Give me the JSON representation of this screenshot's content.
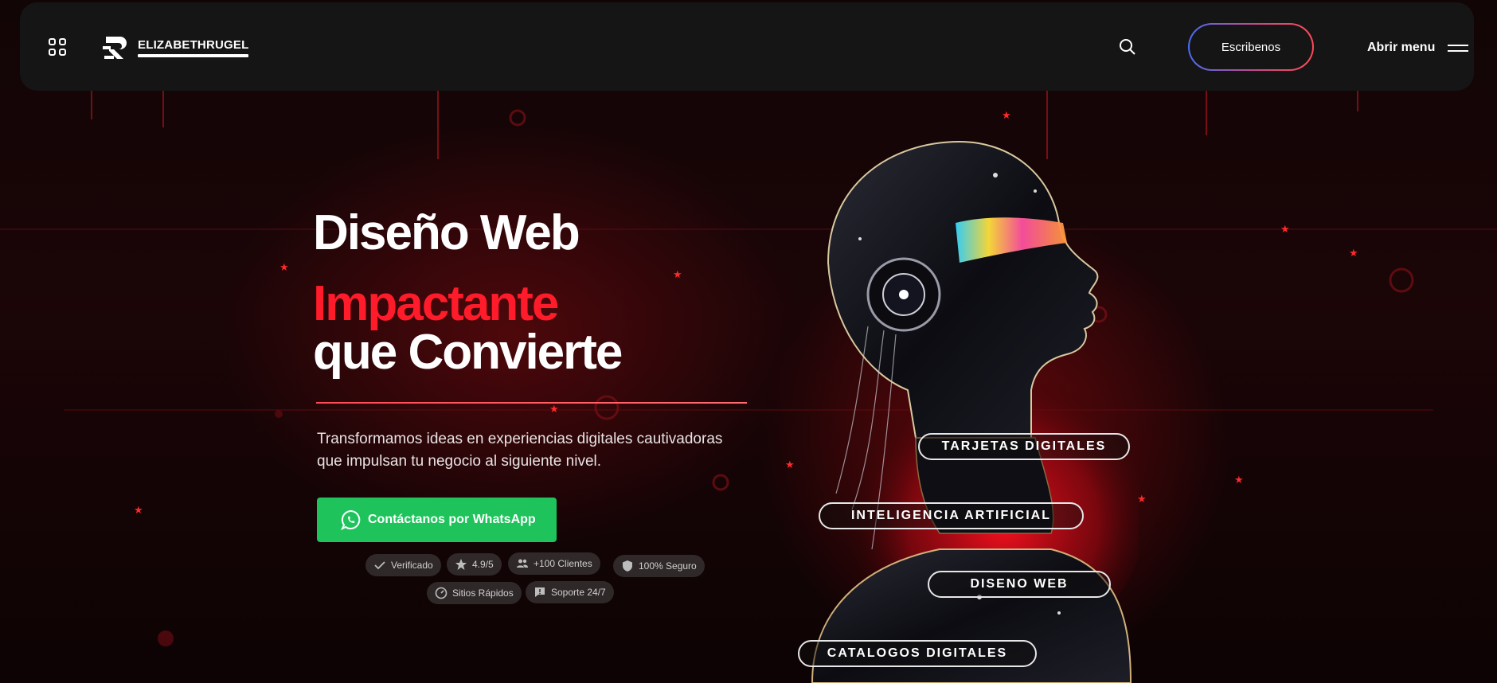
{
  "header": {
    "logo_text": "ELIZABETHRUGEL",
    "cta_label": "Escribenos",
    "menu_label": "Abrir menu"
  },
  "hero": {
    "title_line1": "Diseño Web",
    "title_line2": "Impactante",
    "title_line3": "que Convierte",
    "subtitle": "Transformamos ideas en experiencias digitales cautivadoras que impulsan tu negocio al siguiente nivel.",
    "whatsapp_label": "Contáctanos por WhatsApp"
  },
  "badges": [
    {
      "label": "Verificado",
      "icon": "check-icon"
    },
    {
      "label": "4.9/5",
      "icon": "star-icon"
    },
    {
      "label": "+100 Clientes",
      "icon": "users-icon"
    },
    {
      "label": "100% Seguro",
      "icon": "shield-icon"
    },
    {
      "label": "Sitios Rápidos",
      "icon": "speedometer-icon"
    },
    {
      "label": "Soporte 24/7",
      "icon": "support-icon"
    }
  ],
  "tags": [
    {
      "label": "TARJETAS DIGITALES"
    },
    {
      "label": "INTELIGENCIA ARTIFICIAL"
    },
    {
      "label": "DISENO WEB"
    },
    {
      "label": "CATALOGOS DIGITALES"
    }
  ],
  "colors": {
    "accent_red": "#ff1b2a",
    "whatsapp_green": "#1fc35c",
    "header_bg": "#151516"
  }
}
